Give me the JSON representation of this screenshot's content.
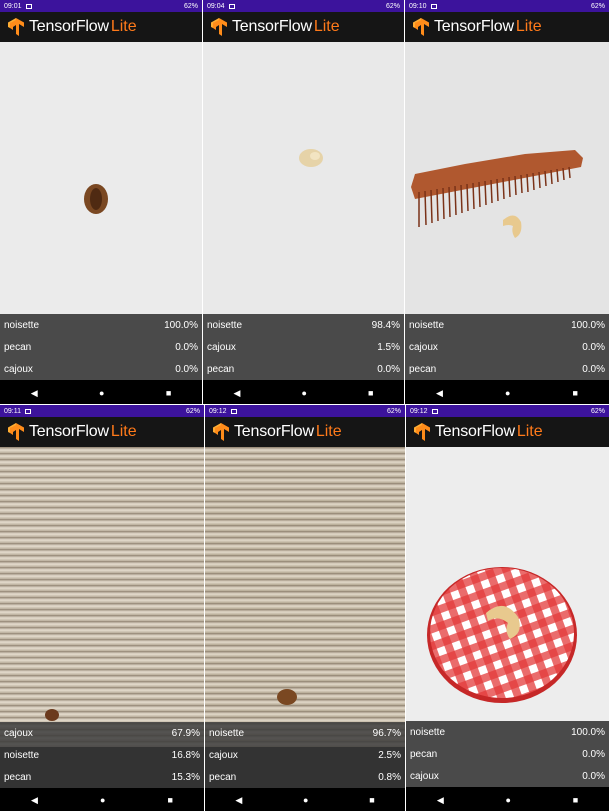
{
  "app": {
    "title_main": "TensorFlow",
    "title_lite": "Lite",
    "accent": "#ff7a1a",
    "status_color": "#3c139c"
  },
  "nav": {
    "back": "◀",
    "home": "●",
    "recents": "■"
  },
  "screens": [
    {
      "time": "09:01",
      "battery": "62%",
      "results": [
        {
          "label": "noisette",
          "value": "100.0%"
        },
        {
          "label": "pecan",
          "value": "0.0%"
        },
        {
          "label": "cajoux",
          "value": "0.0%"
        }
      ]
    },
    {
      "time": "09:04",
      "battery": "62%",
      "results": [
        {
          "label": "noisette",
          "value": "98.4%"
        },
        {
          "label": "cajoux",
          "value": "1.5%"
        },
        {
          "label": "pecan",
          "value": "0.0%"
        }
      ]
    },
    {
      "time": "09:10",
      "battery": "62%",
      "results": [
        {
          "label": "noisette",
          "value": "100.0%"
        },
        {
          "label": "cajoux",
          "value": "0.0%"
        },
        {
          "label": "pecan",
          "value": "0.0%"
        }
      ]
    },
    {
      "time": "09:11",
      "battery": "62%",
      "results": [
        {
          "label": "cajoux",
          "value": "67.9%"
        },
        {
          "label": "noisette",
          "value": "16.8%"
        },
        {
          "label": "pecan",
          "value": "15.3%"
        }
      ]
    },
    {
      "time": "09:12",
      "battery": "62%",
      "results": [
        {
          "label": "noisette",
          "value": "96.7%"
        },
        {
          "label": "cajoux",
          "value": "2.5%"
        },
        {
          "label": "pecan",
          "value": "0.8%"
        }
      ]
    },
    {
      "time": "09:12",
      "battery": "62%",
      "results": [
        {
          "label": "noisette",
          "value": "100.0%"
        },
        {
          "label": "pecan",
          "value": "0.0%"
        },
        {
          "label": "cajoux",
          "value": "0.0%"
        }
      ]
    }
  ]
}
